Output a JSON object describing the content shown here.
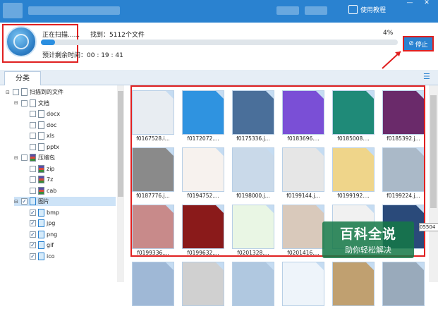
{
  "titlebar": {
    "guide_label": "使用教程",
    "minimize": "—",
    "close": "✕"
  },
  "scan": {
    "status": "正在扫描......",
    "found": "找到：5112个文件",
    "percent_label": "4%",
    "progress": 0.04,
    "eta": "预计剩余时间：00 : 19 : 41",
    "stop_label": "停止"
  },
  "tab": {
    "label": "分类"
  },
  "tree": [
    {
      "label": "扫描到的文件",
      "level": 0,
      "toggle": "⊟",
      "checked": false,
      "icon": "folder"
    },
    {
      "label": "文档",
      "level": 1,
      "toggle": "⊟",
      "checked": false,
      "icon": "doc"
    },
    {
      "label": "docx",
      "level": 2,
      "toggle": "",
      "checked": false,
      "icon": "doc"
    },
    {
      "label": "doc",
      "level": 2,
      "toggle": "",
      "checked": false,
      "icon": "doc"
    },
    {
      "label": "xls",
      "level": 2,
      "toggle": "",
      "checked": false,
      "icon": "doc"
    },
    {
      "label": "pptx",
      "level": 2,
      "toggle": "",
      "checked": false,
      "icon": "doc"
    },
    {
      "label": "压缩包",
      "level": 1,
      "toggle": "⊟",
      "checked": false,
      "icon": "zip"
    },
    {
      "label": "zip",
      "level": 2,
      "toggle": "",
      "checked": false,
      "icon": "zip"
    },
    {
      "label": "7z",
      "level": 2,
      "toggle": "",
      "checked": false,
      "icon": "zip"
    },
    {
      "label": "cab",
      "level": 2,
      "toggle": "",
      "checked": false,
      "icon": "zip"
    },
    {
      "label": "图片",
      "level": 1,
      "toggle": "⊟",
      "checked": true,
      "icon": "img",
      "selected": true
    },
    {
      "label": "bmp",
      "level": 2,
      "toggle": "",
      "checked": true,
      "icon": "img"
    },
    {
      "label": "jpg",
      "level": 2,
      "toggle": "",
      "checked": true,
      "icon": "img"
    },
    {
      "label": "png",
      "level": 2,
      "toggle": "",
      "checked": true,
      "icon": "img"
    },
    {
      "label": "gif",
      "level": 2,
      "toggle": "",
      "checked": true,
      "icon": "img"
    },
    {
      "label": "ico",
      "level": 2,
      "toggle": "",
      "checked": true,
      "icon": "img"
    }
  ],
  "files": [
    {
      "name": "f0167528.i...",
      "color": "#e8edf2",
      "icon": "document-info-icon"
    },
    {
      "name": "f0172072....",
      "color": "#2f93e0",
      "icon": "app-icon"
    },
    {
      "name": "f0175336.j...",
      "color": "#4a6f9a",
      "icon": "poster-image"
    },
    {
      "name": "f0183696....",
      "color": "#7a4fd6",
      "icon": "chat-app-icon"
    },
    {
      "name": "f0185008....",
      "color": "#1f8a78",
      "icon": "green-photo"
    },
    {
      "name": "f0185392.j...",
      "color": "#6a2a6a",
      "icon": "group-photo"
    },
    {
      "name": "f0187776.j...",
      "color": "#8a8a8a",
      "icon": "portrait-photo"
    },
    {
      "name": "f0194752....",
      "color": "#f7f2ee",
      "icon": "cartoon-sprout"
    },
    {
      "name": "f0198000.j...",
      "color": "#c9d9e9",
      "icon": "phone-photo"
    },
    {
      "name": "f0199144.j...",
      "color": "#e6e6e6",
      "icon": "device-photo"
    },
    {
      "name": "f0199192....",
      "color": "#efd58a",
      "icon": "pixel-character"
    },
    {
      "name": "f0199224.j...",
      "color": "#aab9c8",
      "icon": "ship-photo"
    },
    {
      "name": "f0199336....",
      "color": "#c88a8a",
      "icon": "group-photo"
    },
    {
      "name": "f0199632....",
      "color": "#8a1a1a",
      "icon": "banner-photo"
    },
    {
      "name": "f0201328....",
      "color": "#e9f6e4",
      "icon": "frog-cartoon"
    },
    {
      "name": "f0201416....",
      "color": "#d9c9bb",
      "icon": "portrait-photo"
    },
    {
      "name": "",
      "color": "#f1f1f1",
      "icon": "image"
    },
    {
      "name": "",
      "color": "#2a4a7a",
      "icon": "image"
    },
    {
      "name": "",
      "color": "#9fb8d6",
      "icon": "image"
    },
    {
      "name": "",
      "color": "#d0d0d0",
      "icon": "image"
    },
    {
      "name": "",
      "color": "#b0c8e0",
      "icon": "image"
    },
    {
      "name": "",
      "color": "#eef4fa",
      "icon": "image"
    },
    {
      "name": "",
      "color": "#c0a070",
      "icon": "image"
    },
    {
      "name": "",
      "color": "#9ab",
      "icon": "image"
    }
  ],
  "tooltip": "05504",
  "watermark": {
    "line1": "百科全说",
    "line2": "助你轻松解决"
  },
  "colors": {
    "accent": "#2a82d0",
    "highlight": "#e02020"
  }
}
